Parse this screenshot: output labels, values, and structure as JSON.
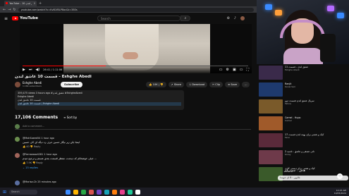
{
  "browser": {
    "tab_title": "YouTube - 10 عاشق لندن",
    "url": "youtube.com/watch?v=KvB1fBLP8oc&t=380s"
  },
  "youtube": {
    "logo_text": "YouTube",
    "search_placeholder": "Search"
  },
  "player": {
    "time": "26:41 / 1:11:06",
    "progress_fraction": 0.37
  },
  "video": {
    "title": "قسمت 10 عاشق لندن - Eshghe Abedi",
    "channel": "Eshghe Abedi",
    "subscribers": "1.16K subscribers",
    "subscribe_label": "Subscribe",
    "actions": {
      "likes": "10K",
      "share": "Share",
      "download": "Download",
      "clip": "Clip",
      "save": "Save",
      "more": "..."
    },
    "description": {
      "stats": "359,475 views  3 hours ago  #عشق_لندن #EshgheAbedi",
      "line2": "Eshghe Abedi",
      "line3": "قسمت 10 عاشق لندن",
      "line4": "قسمت 10 عاشق لندن | Eshghe Abedi"
    }
  },
  "comments": {
    "count_label": "17,106 Comments",
    "sort_label": "Sort by",
    "add_placeholder": "Add a comment...",
    "items": [
      {
        "author": "@MahSaeed54  1 hour ago",
        "text": "اینجا بکن زیر نیگار حسین حرف زد دیگه ای کار، حسین",
        "meta": "👍 40   👎   Reply",
        "color": "#6b8e4e",
        "replies": ""
      },
      {
        "author": "@Farnaaaaz4281  1 hour ago",
        "text": "خیلی خوشحالم که دیدمت. منتظر قسمت بعدی هستم و ترجیح میدم ...",
        "meta": "👍 7.9K   👎   Reply",
        "color": "#a0645a",
        "replies": "⌄ 15 replies"
      },
      {
        "author": "@Marisa.Ch  25 minutes ago",
        "text": "",
        "meta": "",
        "color": "#5a6ea0",
        "replies": ""
      }
    ]
  },
  "sidebar": {
    "videos": [
      {
        "title": "عشق ابدی - قسمت 11",
        "channel": "Eshghe Abedi",
        "views": "",
        "color": "#3a2a4a"
      },
      {
        "title": "Ranjit",
        "channel": "Kanal Sari",
        "views": "",
        "color": "#1e3a6e"
      },
      {
        "title": "سریال عشق لندن قسمت دوم",
        "channel": "Tahira",
        "views": "",
        "color": "#7a5a2a"
      },
      {
        "title": "Camel - Hupo",
        "channel": "Camel",
        "views": "",
        "color": "#a05a2a"
      },
      {
        "title": "کیک و نقشی برای بهینه لندن قسمت 17",
        "channel": "Farsi",
        "views": "",
        "color": "#5a2a3a"
      },
      {
        "title": "تاتی عشقی و عاشق - تاشبه 2",
        "channel": "Koray",
        "views": "",
        "color": "#6e3a4a"
      },
      {
        "title": "کیک و نقشی برای دیستی کاری",
        "channel": "Farsi",
        "views": "",
        "color": "#3a5a2a"
      }
    ]
  },
  "overlay": {
    "line1": "هدف : سوپرپایز",
    "line2": "فالوور : 8 ای جویندا",
    "icon": "♡"
  },
  "taskbar": {
    "search": "Search",
    "time": "10:15 AM",
    "date": "10/05/2024",
    "apps": [
      "#3a8bff",
      "#ffb400",
      "#28a745",
      "#d9534f",
      "#6f42c1",
      "#17a2b8",
      "#ff7f0e",
      "#e83e8c",
      "#20c997",
      "#ffffff"
    ]
  }
}
